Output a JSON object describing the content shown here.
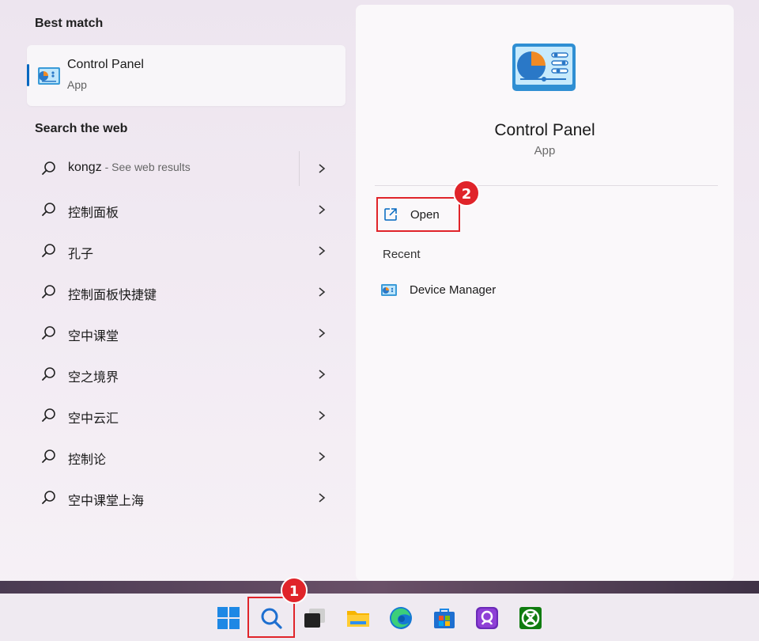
{
  "left": {
    "best_match_title": "Best match",
    "best_match": {
      "name": "Control Panel",
      "type": "App",
      "icon": "control-panel-icon"
    },
    "search_web_title": "Search the web",
    "web_results": [
      {
        "query": "kongz",
        "suffix": " - See web results"
      },
      {
        "query": "控制面板",
        "suffix": ""
      },
      {
        "query": "孔子",
        "suffix": ""
      },
      {
        "query": "控制面板快捷键",
        "suffix": ""
      },
      {
        "query": "空中课堂",
        "suffix": ""
      },
      {
        "query": "空之境界",
        "suffix": ""
      },
      {
        "query": "空中云汇",
        "suffix": ""
      },
      {
        "query": "控制论",
        "suffix": ""
      },
      {
        "query": "空中课堂上海",
        "suffix": ""
      }
    ]
  },
  "detail": {
    "title": "Control Panel",
    "type": "App",
    "open_label": "Open",
    "recent_label": "Recent",
    "recent_items": [
      {
        "label": "Device Manager",
        "icon": "device-manager-icon"
      }
    ]
  },
  "badges": {
    "step1": "1",
    "step2": "2"
  },
  "taskbar": {
    "icons": [
      "windows-start-icon",
      "search-icon",
      "task-view-icon",
      "file-explorer-icon",
      "edge-icon",
      "store-icon",
      "clipchamp-icon",
      "xbox-icon"
    ]
  },
  "colors": {
    "accent": "#0067c0",
    "highlight": "#e0242a"
  }
}
